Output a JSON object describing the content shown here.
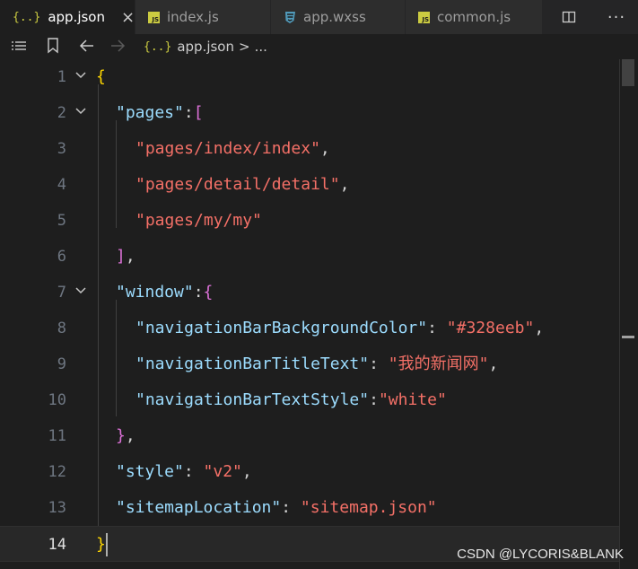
{
  "tabs": [
    {
      "label": "app.json",
      "icon": "json-icon",
      "active": true,
      "close": "×"
    },
    {
      "label": "index.js",
      "icon": "js-icon",
      "active": false
    },
    {
      "label": "app.wxss",
      "icon": "css-icon",
      "active": false
    },
    {
      "label": "common.js",
      "icon": "js-icon",
      "active": false
    }
  ],
  "tab_icons": {
    "json": "{..}",
    "js": "JS"
  },
  "toolbar": {
    "more": "···"
  },
  "breadcrumb": {
    "file": "app.json",
    "separator": ">",
    "rest": "..."
  },
  "lines": [
    {
      "n": "1"
    },
    {
      "n": "2"
    },
    {
      "n": "3"
    },
    {
      "n": "4"
    },
    {
      "n": "5"
    },
    {
      "n": "6"
    },
    {
      "n": "7"
    },
    {
      "n": "8"
    },
    {
      "n": "9"
    },
    {
      "n": "10"
    },
    {
      "n": "11"
    },
    {
      "n": "12"
    },
    {
      "n": "13"
    },
    {
      "n": "14"
    }
  ],
  "code": {
    "l1_open": "{",
    "pages_key": "\"pages\"",
    "colon": ":",
    "colon_sp": ": ",
    "comma": ",",
    "open_bracket": "[",
    "page1": "\"pages/index/index\"",
    "page2": "\"pages/detail/detail\"",
    "page3": "\"pages/my/my\"",
    "close_bracket": "]",
    "window_key": "\"window\"",
    "open_brace": "{",
    "close_brace": "}",
    "nav_bg_key": "\"navigationBarBackgroundColor\"",
    "nav_bg_val": "\"#328eeb\"",
    "nav_title_key": "\"navigationBarTitleText\"",
    "nav_title_val": "\"我的新闻网\"",
    "nav_style_key": "\"navigationBarTextStyle\"",
    "nav_style_val": "\"white\"",
    "style_key": "\"style\"",
    "style_val": "\"v2\"",
    "sitemap_key": "\"sitemapLocation\"",
    "sitemap_val": "\"sitemap.json\"",
    "l14_close": "}"
  },
  "current_line": 14,
  "watermark": "CSDN @LYCORIS&BLANK",
  "colors": {
    "key": "#9cdcfe",
    "string": "#f47067",
    "bracket_level1": "#ffd700",
    "bracket_level2": "#da70d6",
    "bracket_level3": "#179fff",
    "js_icon": "#cbcb41",
    "css_icon": "#519aba"
  }
}
